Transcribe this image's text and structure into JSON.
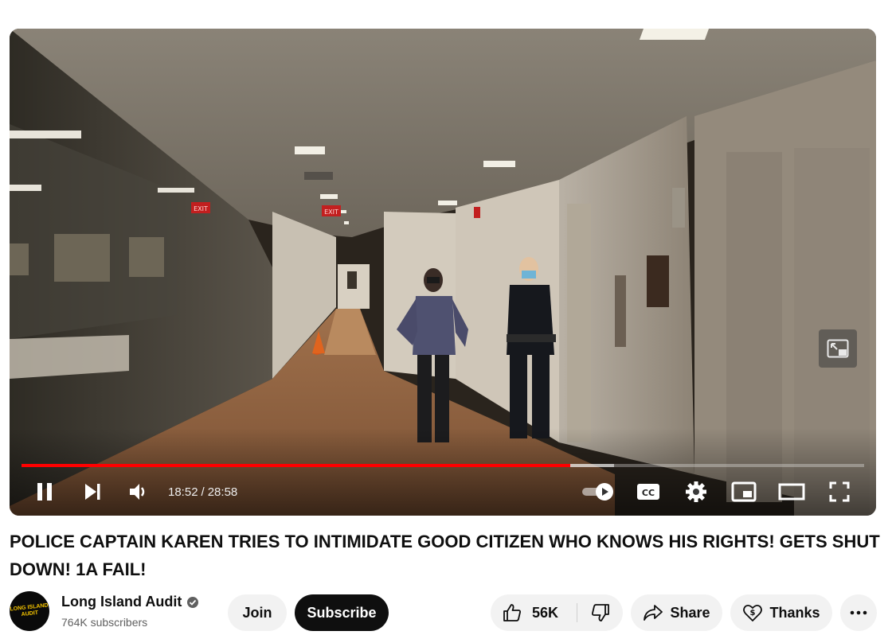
{
  "player": {
    "current_time": "18:52",
    "separator": "/",
    "duration": "28:58",
    "played_fraction": 0.651,
    "loaded_fraction": 0.703,
    "progress_color": "#ff0000",
    "exit_signs": [
      "EXIT",
      "EXIT"
    ]
  },
  "controls": {
    "pause": "pause-icon",
    "next": "next-icon",
    "volume": "volume-icon",
    "autoplay": "autoplay-toggle-icon",
    "captions": "captions-icon",
    "settings": "gear-icon",
    "miniplayer": "miniplayer-icon",
    "theater": "theater-mode-icon",
    "fullscreen": "fullscreen-icon"
  },
  "video": {
    "title": "POLICE CAPTAIN KAREN TRIES TO INTIMIDATE GOOD CITIZEN WHO KNOWS HIS RIGHTS! GETS SHUT DOWN! 1A FAIL!"
  },
  "channel": {
    "name": "Long Island Audit",
    "subscribers": "764K subscribers",
    "avatar_text": "LONG ISLAND AUDIT",
    "verified": true
  },
  "actions": {
    "join": "Join",
    "subscribe": "Subscribe",
    "likes": "56K",
    "share": "Share",
    "thanks": "Thanks",
    "more": "more-icon"
  }
}
